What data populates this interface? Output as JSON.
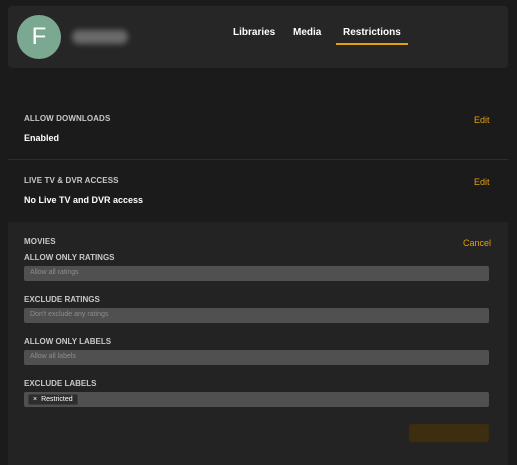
{
  "header": {
    "avatar_letter": "F",
    "tabs": [
      {
        "label": "Libraries"
      },
      {
        "label": "Media"
      },
      {
        "label": "Restrictions"
      }
    ]
  },
  "downloads": {
    "title": "ALLOW DOWNLOADS",
    "value": "Enabled",
    "action": "Edit"
  },
  "livetv": {
    "title": "LIVE TV & DVR ACCESS",
    "value": "No Live TV and DVR access",
    "action": "Edit"
  },
  "movies": {
    "title": "MOVIES",
    "action": "Cancel",
    "fields": [
      {
        "label": "ALLOW ONLY RATINGS",
        "placeholder": "Allow all ratings"
      },
      {
        "label": "EXCLUDE RATINGS",
        "placeholder": "Don't exclude any ratings"
      },
      {
        "label": "ALLOW ONLY LABELS",
        "placeholder": "Allow all labels"
      },
      {
        "label": "EXCLUDE LABELS",
        "tag": "Restricted",
        "tag_remove": "×"
      }
    ]
  },
  "colors": {
    "accent": "#e5a00d",
    "avatar": "#7aa890",
    "background": "#1b1b1b"
  }
}
